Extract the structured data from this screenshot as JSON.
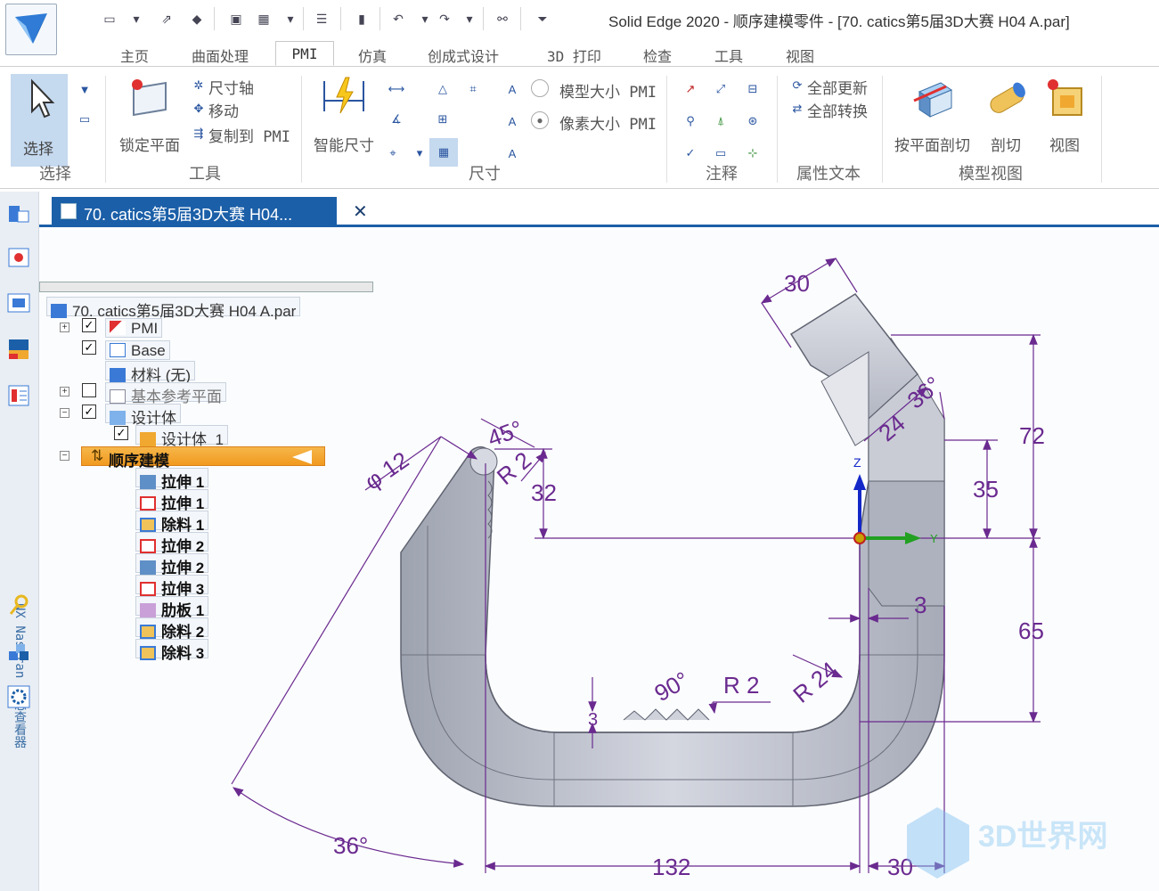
{
  "window": {
    "title": "Solid Edge 2020 - 顺序建模零件 - [70. catics第5届3D大赛 H04 A.par]"
  },
  "tabs": [
    {
      "label": "主页"
    },
    {
      "label": "曲面处理"
    },
    {
      "label": "PMI"
    },
    {
      "label": "仿真"
    },
    {
      "label": "创成式设计"
    },
    {
      "label": "3D 打印"
    },
    {
      "label": "检查"
    },
    {
      "label": "工具"
    },
    {
      "label": "视图"
    }
  ],
  "ribbon": {
    "select": {
      "label": "选择",
      "group": "选择"
    },
    "tools": {
      "lock_plane": "锁定平面",
      "dim_axis": "尺寸轴",
      "move": "移动",
      "copy_to_pmi": "复制到 PMI",
      "group": "工具"
    },
    "dimension": {
      "smart_dim": "智能尺寸",
      "model_size_pmi": "模型大小 PMI",
      "pixel_size_pmi": "像素大小 PMI",
      "group": "尺寸"
    },
    "annotation": {
      "group": "注释"
    },
    "property_text": {
      "update_all": "全部更新",
      "convert_all": "全部转换",
      "group": "属性文本"
    },
    "model_view": {
      "plane_section": "按平面剖切",
      "section": "剖切",
      "view": "视图",
      "group": "模型视图"
    }
  },
  "leftbar": {
    "nastran_label": "NX Nastran 日志查看器"
  },
  "document": {
    "tab_title": "70. catics第5届3D大赛 H04...",
    "close": "✕"
  },
  "tree": {
    "root": "70. catics第5届3D大赛 H04 A.par",
    "pmi": "PMI",
    "base": "Base",
    "material": "材料 (无)",
    "ref_planes": "基本参考平面",
    "design_body": "设计体",
    "design_body_1": "设计体_1",
    "ordered": "顺序建模",
    "features": [
      "拉伸 1",
      "拉伸 1",
      "除料 1",
      "拉伸 2",
      "拉伸 2",
      "拉伸 3",
      "肋板 1",
      "除料 2",
      "除料 3"
    ]
  },
  "dimensions": {
    "d30_top": "30",
    "d72": "72",
    "d24": "24",
    "d36_small": "36°",
    "d35": "35",
    "d45": "45°",
    "dR2_top": "R 2",
    "d32": "32",
    "dphi12": "φ 12",
    "d3_right": "3",
    "d65": "65",
    "dR24": "R 24",
    "d90": "90°",
    "dR2_bottom": "R 2",
    "d3_bottom": "3",
    "d36_big": "36°",
    "d132": "132",
    "d30_bottom": "30"
  },
  "axes": {
    "z": "Z",
    "y": "Y"
  },
  "watermark": "3D世界网",
  "colors": {
    "dimension": "#6a2a8f",
    "accent": "#1b5fa8",
    "part": "#c2c6d0",
    "active_node": "#f19a1f"
  }
}
